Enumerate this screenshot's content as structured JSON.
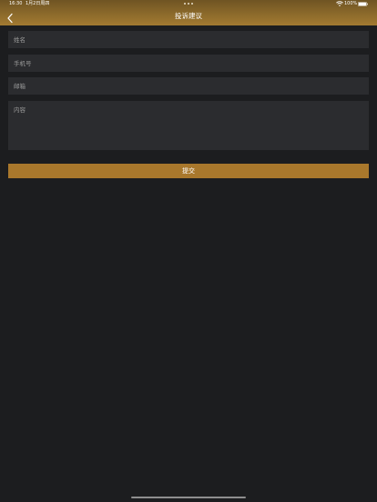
{
  "status_bar": {
    "time": "16:30",
    "date": "1月2日周四",
    "battery_text": "100%",
    "icons": [
      "wifi-icon",
      "battery-icon"
    ]
  },
  "nav": {
    "title": "投诉建议",
    "back_icon": "chevron-left-icon"
  },
  "form": {
    "name_placeholder": "姓名",
    "phone_placeholder": "手机号",
    "email_placeholder": "邮箱",
    "content_placeholder": "内容",
    "name_value": "",
    "phone_value": "",
    "email_value": "",
    "content_value": "",
    "submit_label": "提交"
  },
  "colors": {
    "header_top": "#6f5423",
    "header_bottom": "#a27a31",
    "background": "#1c1d1f",
    "field_bg": "#2b2c2f",
    "accent": "#a9782c"
  }
}
